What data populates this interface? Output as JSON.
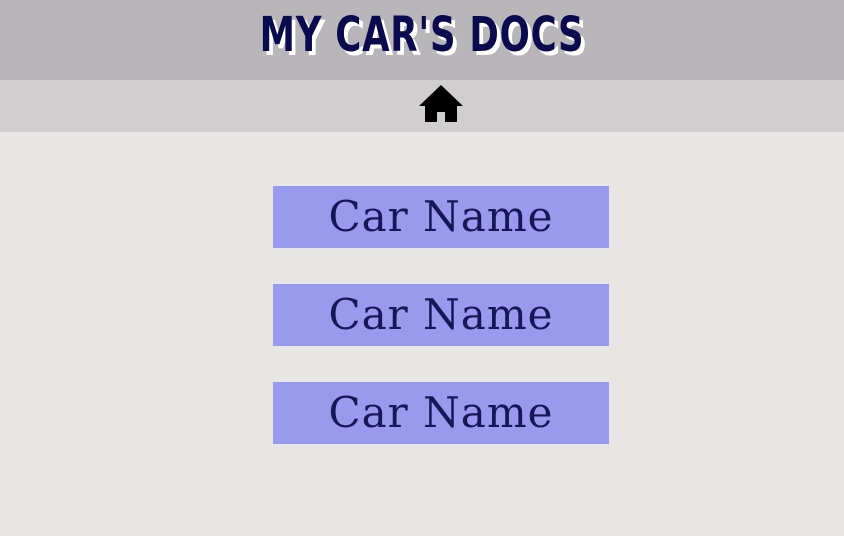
{
  "header": {
    "title": "MY CAR'S DOCS"
  },
  "nav": {
    "home_icon": "home-icon"
  },
  "cars": [
    {
      "label": "Car Name"
    },
    {
      "label": "Car Name"
    },
    {
      "label": "Car Name"
    }
  ],
  "colors": {
    "header_bg": "#b8b6b9",
    "nav_bg": "#d0cecf",
    "page_bg": "#e8e6e5",
    "title_color": "#0a0a4e",
    "button_bg": "#9999ee",
    "button_text": "#171758"
  }
}
